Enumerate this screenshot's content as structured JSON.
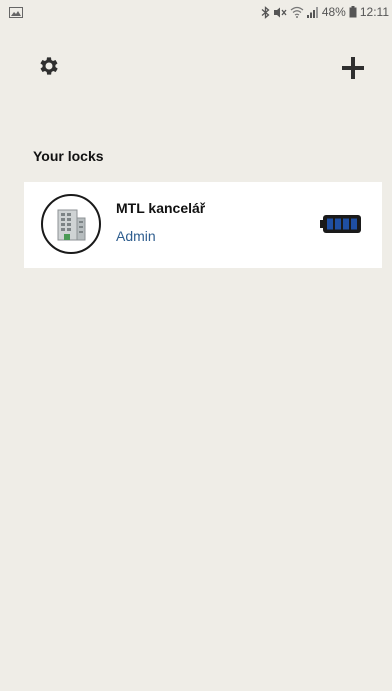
{
  "status_bar": {
    "battery_percent": "48%",
    "time": "12:11",
    "icons": [
      "image-notification-icon",
      "bluetooth-icon",
      "mute-icon",
      "wifi-icon",
      "signal-icon",
      "battery-icon"
    ]
  },
  "toolbar": {
    "settings_icon": "gear-icon",
    "add_icon": "plus-icon"
  },
  "section": {
    "title": "Your locks"
  },
  "locks": [
    {
      "name": "MTL kancelář",
      "role": "Admin",
      "icon": "building-icon",
      "battery_icon": "battery-full-icon",
      "battery_level": 1.0
    }
  ],
  "colors": {
    "background": "#efede7",
    "role_text": "#2f5e8f",
    "battery_fill": "#1f4fa3",
    "icon_dark": "#2f2f2f"
  }
}
